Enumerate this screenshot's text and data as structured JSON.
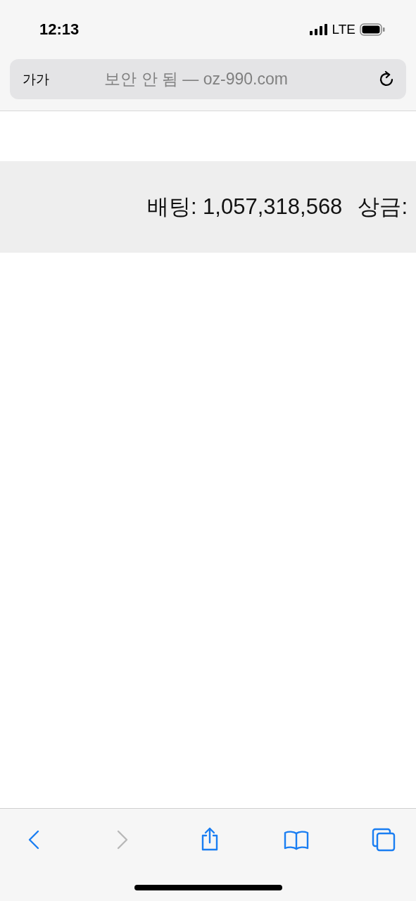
{
  "status_bar": {
    "time": "12:13",
    "network": "LTE"
  },
  "address_bar": {
    "text_size_button": "가가",
    "url_text": "보안 안 됨 — oz-990.com"
  },
  "banner": {
    "items": [
      {
        "text": "배팅: 1,057,318,568"
      },
      {
        "text": "상금:"
      }
    ]
  },
  "toolbar": {
    "buttons": [
      {
        "kind": "back",
        "disabled": false
      },
      {
        "kind": "forward",
        "disabled": true
      },
      {
        "kind": "share",
        "disabled": false
      },
      {
        "kind": "bookmarks",
        "disabled": false
      },
      {
        "kind": "tabs",
        "disabled": false
      }
    ]
  }
}
